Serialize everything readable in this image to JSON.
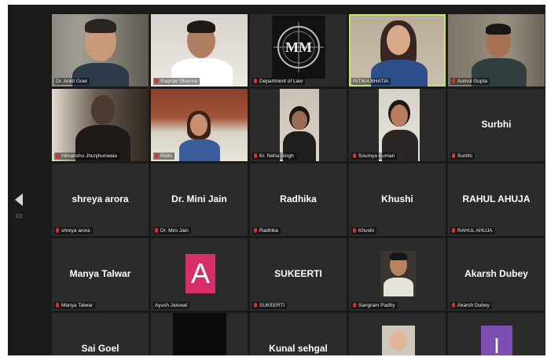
{
  "pager": {
    "page": "1/2"
  },
  "tiles": [
    {
      "label": "Dr. Ankit Goel"
    },
    {
      "label": "Raghav Sharma"
    },
    {
      "label": "Department of Law",
      "logo": "MM"
    },
    {
      "label": "RITIKA BHATIA"
    },
    {
      "label": "Anmol Gupta"
    },
    {
      "label": "Himanshu Jhunjhunwala"
    },
    {
      "label": "Ridhi"
    },
    {
      "label": "Kr. Neha Singh"
    },
    {
      "label": "Soumya Kumari"
    },
    {
      "name": "Surbhi",
      "label": "Surbhi"
    },
    {
      "name": "shreya arora",
      "label": "shreya arora"
    },
    {
      "name": "Dr. Mini Jain",
      "label": "Dr. Mini Jain"
    },
    {
      "name": "Radhika",
      "label": "Radhika"
    },
    {
      "name": "Khushi",
      "label": "Khushi"
    },
    {
      "name": "RAHUL AHUJA",
      "label": "RAHUL AHUJA"
    },
    {
      "name": "Manya Talwar",
      "label": "Manya Talwar"
    },
    {
      "avatar": "A",
      "label": "Ayush Jaiswal"
    },
    {
      "name": "SUKEERTI",
      "label": "SUKEERTI"
    },
    {
      "label": "Sangram Padhy"
    },
    {
      "name": "Akarsh Dubey",
      "label": "Akarsh Dubey"
    },
    {
      "name": "Sai Goel"
    },
    {},
    {
      "name": "Kunal sehgal"
    },
    {},
    {
      "avatar": "I"
    }
  ]
}
